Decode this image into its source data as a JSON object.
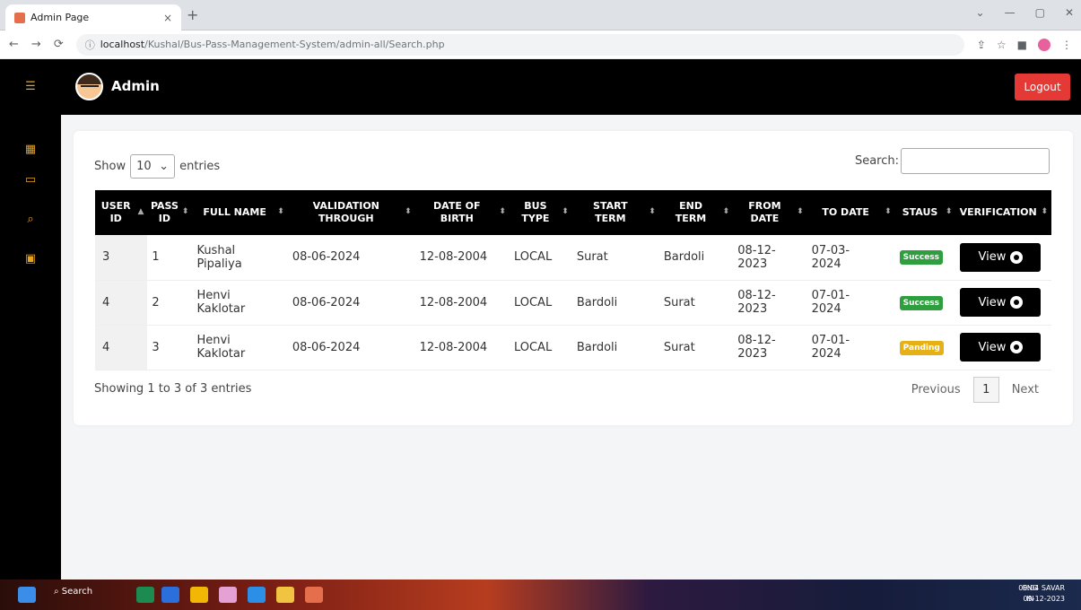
{
  "browser": {
    "tab_title": "Admin Page",
    "tab_close": "×",
    "new_tab": "+",
    "url_host": "localhost",
    "url_path": "/Kushal/Bus-Pass-Management-System/admin-all/Search.php",
    "controls": {
      "minimize": "—",
      "maximize": "▢",
      "close": "✕"
    }
  },
  "sidebar": {
    "items": [
      "menu-icon",
      "dashboard-icon",
      "chat-icon",
      "search-icon",
      "report-icon"
    ]
  },
  "header": {
    "title": "Admin",
    "logout_label": "Logout"
  },
  "table_controls": {
    "show_label": "Show",
    "length_value": "10",
    "entries_label": "entries",
    "search_label": "Search:",
    "search_value": ""
  },
  "columns": [
    {
      "line1": "USER",
      "line2": "ID"
    },
    {
      "line1": "PASS",
      "line2": "ID"
    },
    {
      "line1": "FULL NAME",
      "line2": ""
    },
    {
      "line1": "VALIDATION",
      "line2": "THROUGH"
    },
    {
      "line1": "DATE OF",
      "line2": "BIRTH"
    },
    {
      "line1": "BUS",
      "line2": "TYPE"
    },
    {
      "line1": "START",
      "line2": "TERM"
    },
    {
      "line1": "END",
      "line2": "TERM"
    },
    {
      "line1": "FROM",
      "line2": "DATE"
    },
    {
      "line1": "TO DATE",
      "line2": ""
    },
    {
      "line1": "STAUS",
      "line2": ""
    },
    {
      "line1": "VERIFICATION",
      "line2": ""
    }
  ],
  "rows": [
    {
      "user_id": "3",
      "pass_id": "1",
      "name1": "Kushal",
      "name2": "Pipaliya",
      "validation": "08-06-2024",
      "dob": "12-08-2004",
      "bus_type": "LOCAL",
      "start": "Surat",
      "end": "Bardoli",
      "from": "08-12-2023",
      "to1": "07-03-",
      "to2": "2024",
      "status": "Success",
      "status_color": "#2e9e3f",
      "view": "View"
    },
    {
      "user_id": "4",
      "pass_id": "2",
      "name1": "Henvi",
      "name2": "Kaklotar",
      "validation": "08-06-2024",
      "dob": "12-08-2004",
      "bus_type": "LOCAL",
      "start": "Bardoli",
      "end": "Surat",
      "from": "08-12-2023",
      "to1": "07-01-",
      "to2": "2024",
      "status": "Success",
      "status_color": "#2e9e3f",
      "view": "View"
    },
    {
      "user_id": "4",
      "pass_id": "3",
      "name1": "Henvi",
      "name2": "Kaklotar",
      "validation": "08-06-2024",
      "dob": "12-08-2004",
      "bus_type": "LOCAL",
      "start": "Bardoli",
      "end": "Surat",
      "from": "08-12-2023",
      "to1": "07-01-",
      "to2": "2024",
      "status": "Panding",
      "status_color": "#e6b117",
      "view": "View"
    }
  ],
  "footer": {
    "info": "Showing 1 to 3 of 3 entries",
    "previous": "Previous",
    "page": "1",
    "next": "Next"
  },
  "taskbar": {
    "search": "Search",
    "lang1": "ENG",
    "lang2": "IN",
    "time": "09:04 SAVAR",
    "date": "09-12-2023"
  }
}
